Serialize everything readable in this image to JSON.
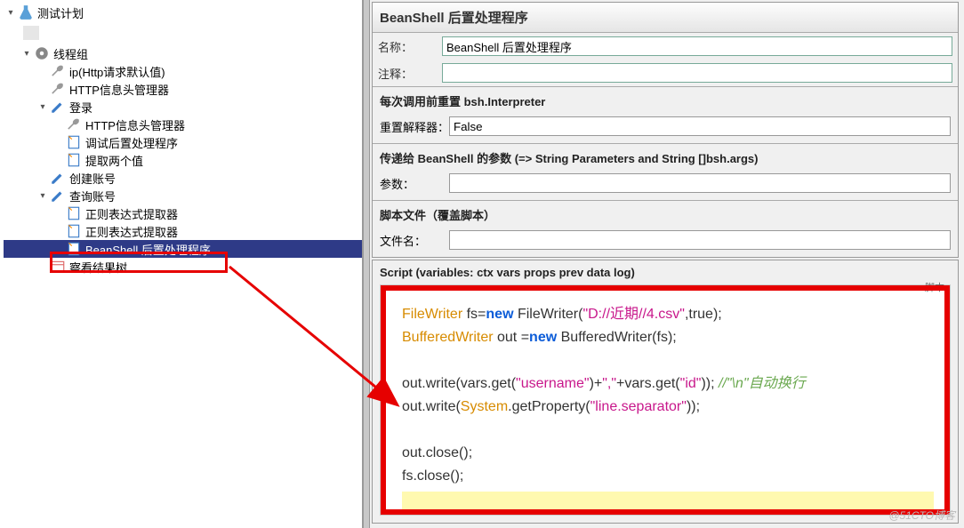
{
  "tree": {
    "root": "测试计划",
    "n1": "线程组",
    "n1_1": "ip(Http请求默认值)",
    "n1_2": "HTTP信息头管理器",
    "n1_3": "登录",
    "n1_3_1": "HTTP信息头管理器",
    "n1_3_2": "调试后置处理程序",
    "n1_3_3": "提取两个值",
    "n1_4": "创建账号",
    "n1_5": "查询账号",
    "n1_5_1": "正则表达式提取器",
    "n1_5_2": "正则表达式提取器",
    "n1_5_3": "BeanShell 后置处理程序",
    "n1_6": "察看结果树"
  },
  "header": {
    "title": "BeanShell 后置处理程序"
  },
  "form": {
    "name_label": "名称：",
    "name_value": "BeanShell 后置处理程序",
    "comment_label": "注释：",
    "comment_value": ""
  },
  "reset": {
    "title": "每次调用前重置 bsh.Interpreter",
    "field_label": "重置解释器：",
    "field_value": "False"
  },
  "params": {
    "title": "传递给 BeanShell 的参数 (=> String Parameters and String []bsh.args)",
    "field_label": "参数：",
    "field_value": ""
  },
  "file": {
    "title": "脚本文件（覆盖脚本）",
    "field_label": "文件名：",
    "field_value": ""
  },
  "script": {
    "title": "Script (variables: ctx vars props prev data log)",
    "corner": "脚本"
  },
  "code": {
    "l1a": "FileWriter",
    "l1b": " fs=",
    "l1c": "new",
    "l1d": " FileWriter(",
    "l1e": "\"D://近期//4.csv\"",
    "l1f": ",true);",
    "l2a": "BufferedWriter",
    "l2b": " out =",
    "l2c": "new",
    "l2d": " BufferedWriter(fs);",
    "l4a": "out.write(vars.get(",
    "l4b": "\"username\"",
    "l4c": ")+",
    "l4d": "\",\"",
    "l4e": "+vars.get(",
    "l4f": "\"id\"",
    "l4g": "));    ",
    "l4h": "//\"\\n\"自动换行",
    "l5a": "out.write(",
    "l5b": "System",
    "l5c": ".getProperty(",
    "l5d": "\"line.separator\"",
    "l5e": "));",
    "l7": "out.close();",
    "l8": "fs.close();"
  },
  "watermark": "@51CTO博客"
}
